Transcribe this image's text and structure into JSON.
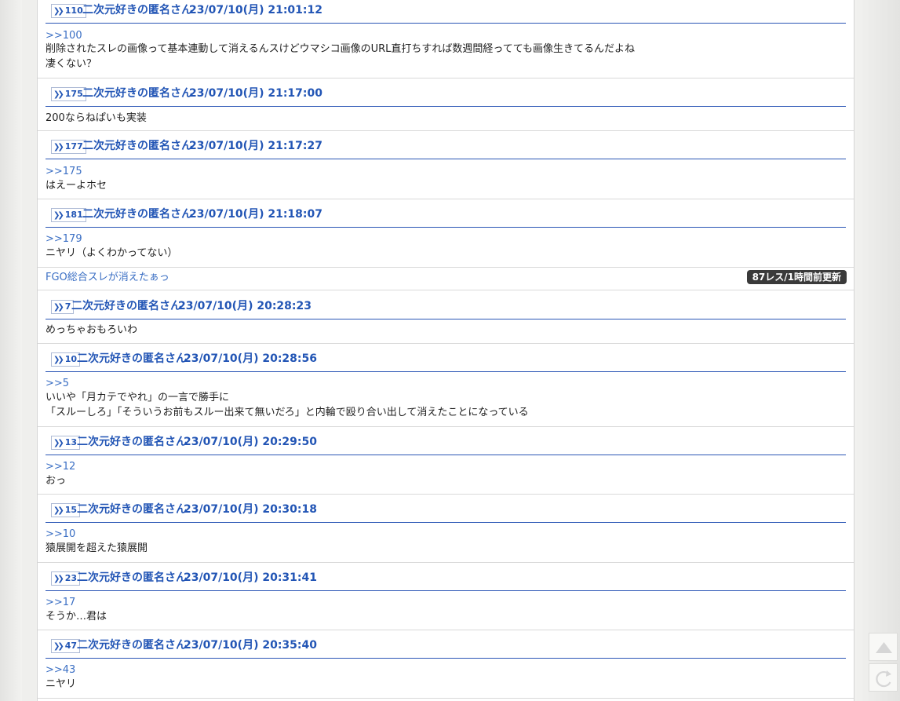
{
  "top_posts": [
    {
      "number": "110",
      "name": "二次元好きの匿名さん",
      "date": "23/07/10(月) 21:01:12",
      "anchor": ">>100",
      "lines": [
        "削除されたスレの画像って基本連動して消えるんスけどウマシコ画像のURL直打ちすれば数週間経ってても画像生きてるんだよね",
        "凄くない？"
      ]
    },
    {
      "number": "175",
      "name": "二次元好きの匿名さん",
      "date": "23/07/10(月) 21:17:00",
      "anchor": "",
      "lines": [
        "200ならねぱいも実装"
      ]
    },
    {
      "number": "177",
      "name": "二次元好きの匿名さん",
      "date": "23/07/10(月) 21:17:27",
      "anchor": ">>175",
      "lines": [
        "はえーよホセ"
      ]
    },
    {
      "number": "181",
      "name": "二次元好きの匿名さん",
      "date": "23/07/10(月) 21:18:07",
      "anchor": ">>179",
      "lines": [
        "ニヤリ（よくわかってない）"
      ]
    }
  ],
  "thread": {
    "title": "FGO総合スレが消えたぁっ",
    "badge": "87レス/1時間前更新"
  },
  "bottom_posts": [
    {
      "number": "7",
      "name": "二次元好きの匿名さん",
      "date": "23/07/10(月) 20:28:23",
      "anchor": "",
      "lines": [
        "めっちゃおもろいわ"
      ]
    },
    {
      "number": "10",
      "name": "二次元好きの匿名さん",
      "date": "23/07/10(月) 20:28:56",
      "anchor": ">>5",
      "lines": [
        "いいや「月カテでやれ」の一言で勝手に",
        "「スルーしろ」「そういうお前もスルー出来て無いだろ」と内輪で殴り合い出して消えたことになっている"
      ]
    },
    {
      "number": "13",
      "name": "二次元好きの匿名さん",
      "date": "23/07/10(月) 20:29:50",
      "anchor": ">>12",
      "lines": [
        "おっ"
      ]
    },
    {
      "number": "15",
      "name": "二次元好きの匿名さん",
      "date": "23/07/10(月) 20:30:18",
      "anchor": ">>10",
      "lines": [
        "猿展開を超えた猿展開"
      ]
    },
    {
      "number": "23",
      "name": "二次元好きの匿名さん",
      "date": "23/07/10(月) 20:31:41",
      "anchor": ">>17",
      "lines": [
        "そうか…君は"
      ]
    },
    {
      "number": "47",
      "name": "二次元好きの匿名さん",
      "date": "23/07/10(月) 20:35:40",
      "anchor": ">>43",
      "lines": [
        "ニヤリ"
      ]
    }
  ],
  "side_buttons": {
    "top_icon": "triangle-up-icon",
    "reload_icon": "reload-icon"
  },
  "colors": {
    "link_blue": "#2255b5",
    "anchor_blue": "#3b6fc4",
    "badge_dark": "#3a3a3a"
  }
}
